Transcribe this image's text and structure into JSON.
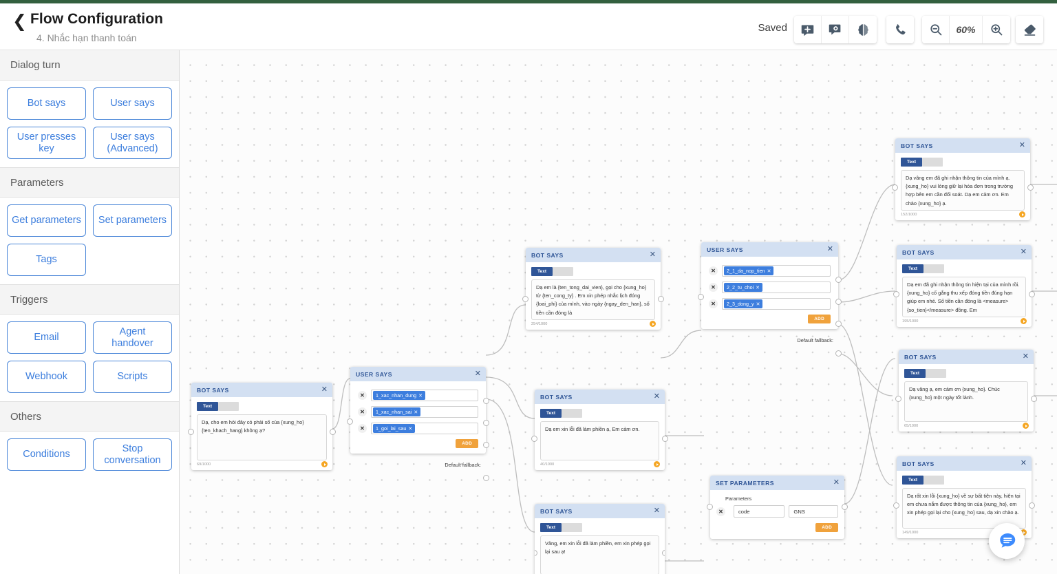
{
  "header": {
    "back_icon": "chevron-left-icon",
    "title": "Flow Configuration",
    "subtitle": "4. Nhắc hạn thanh toán",
    "status": "Saved",
    "zoom_level": "60%",
    "tools": [
      {
        "name": "add-message-icon",
        "label": "Add message"
      },
      {
        "name": "message-settings-icon",
        "label": "Message settings"
      },
      {
        "name": "brain-icon",
        "label": "AI brain"
      },
      {
        "name": "phone-icon",
        "label": "Call"
      },
      {
        "name": "zoom-out-icon",
        "label": "Zoom out"
      },
      {
        "name": "zoom-in-icon",
        "label": "Zoom in"
      },
      {
        "name": "eraser-icon",
        "label": "Erase"
      }
    ]
  },
  "sidebar": {
    "sections": [
      {
        "title": "Dialog turn",
        "items": [
          {
            "label": "Bot says"
          },
          {
            "label": "User says"
          },
          {
            "label": "User presses key"
          },
          {
            "label": "User says (Advanced)"
          }
        ]
      },
      {
        "title": "Parameters",
        "items": [
          {
            "label": "Get parameters"
          },
          {
            "label": "Set parameters"
          },
          {
            "label": "Tags"
          }
        ]
      },
      {
        "title": "Triggers",
        "items": [
          {
            "label": "Email"
          },
          {
            "label": "Agent handover"
          },
          {
            "label": "Webhook"
          },
          {
            "label": "Scripts"
          }
        ]
      },
      {
        "title": "Others",
        "items": [
          {
            "label": "Conditions"
          },
          {
            "label": "Stop conversation"
          }
        ]
      }
    ]
  },
  "canvas": {
    "tab_text_label": "Text",
    "add_label": "ADD",
    "fallback_label": "Default fallback:",
    "parameters_label": "Parameters",
    "nodes": [
      {
        "id": "bot1",
        "type": "BOT SAYS",
        "text": "Dạ, cho em hỏi đây có phải số của {xung_ho} {ten_khach_hang} không ạ?",
        "count": "69/1000"
      },
      {
        "id": "user1",
        "type": "USER SAYS",
        "tags": [
          "1_xac_nhan_dung",
          "1_xac_nhan_sai",
          "1_goi_lai_sau"
        ]
      },
      {
        "id": "bot2",
        "type": "BOT SAYS",
        "text": "Dạ em là {ten_tong_dai_vien}, gọi cho {xung_ho} từ {ten_cong_ty} . Em xin phép nhắc lịch đóng {loai_phi} của mình, vào ngày {ngay_den_han}, số tiền cần đóng là",
        "count": "254/1000"
      },
      {
        "id": "bot3",
        "type": "BOT SAYS",
        "text": "Dạ em xin lỗi đã làm phiền ạ, Em cảm ơn.",
        "count": "40/1000"
      },
      {
        "id": "bot4",
        "type": "BOT SAYS",
        "text": "Vâng, em xin lỗi đã làm phiền, em xin phép gọi lại sau ạ!",
        "count": ""
      },
      {
        "id": "user2",
        "type": "USER SAYS",
        "tags": [
          "2_1_da_nop_tien",
          "2_2_tu_choi",
          "2_3_dong_y"
        ]
      },
      {
        "id": "setparams",
        "type": "SET PARAMETERS",
        "param_key": "code",
        "param_value": "GNS"
      },
      {
        "id": "bot5",
        "type": "BOT SAYS",
        "text": "Dạ vâng em đã ghi nhận thông tin của mình ạ. {xung_ho} vui lòng giữ lại hóa đơn trong trường hợp bên em cần đối soát. Dạ em cảm ơn. Em chào {xung_ho} ạ.",
        "count": "152/1000"
      },
      {
        "id": "bot6",
        "type": "BOT SAYS",
        "text": "Dạ em đã ghi nhận thông tin hiện tại của mình rồi. {xung_ho} cố gắng thu xếp đóng tiền đúng hạn giúp em nhé. Số tiền cần đóng là <measure>{so_tien}</measure> đồng. Em",
        "count": "195/1000"
      },
      {
        "id": "bot7",
        "type": "BOT SAYS",
        "text": "Dạ vâng ạ, em cảm ơn {xung_ho}. Chúc {xung_ho} một ngày tốt lành.",
        "count": "65/1000"
      },
      {
        "id": "bot8",
        "type": "BOT SAYS",
        "text": "Dạ rất xin lỗi {xung_ho} về sự bất tiện này, hiện tại em chưa nắm được thông tin của {xung_ho}, em xin phép gọi lại cho {xung_ho} sau, dạ xin chào ạ.",
        "count": "149/1000"
      }
    ],
    "chat_fab_icon": "chat-bubble-icon"
  },
  "colors": {
    "accent_green": "#33603f",
    "node_header": "#d3e0f2",
    "node_title": "#2f5596",
    "tag_blue": "#3d7ede",
    "add_orange": "#f0a23c",
    "palette_blue": "#3b7ddd",
    "fab_blue": "#3d8bfd"
  }
}
